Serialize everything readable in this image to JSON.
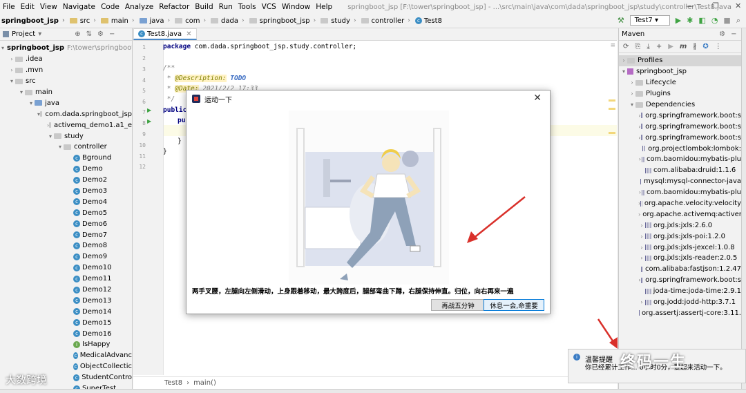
{
  "menu": [
    "File",
    "Edit",
    "View",
    "Navigate",
    "Code",
    "Analyze",
    "Refactor",
    "Build",
    "Run",
    "Tools",
    "VCS",
    "Window",
    "Help"
  ],
  "window_title": "springboot_jsp [F:\\tower\\springboot_jsp] - ...\\src\\main\\java\\com\\dada\\springboot_jsp\\study\\controller\\Test8.java",
  "breadcrumbs": [
    "springboot_jsp",
    "src",
    "main",
    "java",
    "com",
    "dada",
    "springboot_jsp",
    "study",
    "controller",
    "Test8"
  ],
  "run_config": "Test7",
  "project": {
    "header": "Project",
    "root_name": "springboot_jsp",
    "root_path": "F:\\tower\\springboot",
    "items": [
      ".idea",
      ".mvn",
      "src",
      "main",
      "java",
      "com.dada.springboot_jsp",
      "activemq_demo1.a1_e",
      "study",
      "controller"
    ],
    "classes": [
      "Bground",
      "Demo",
      "Demo2",
      "Demo3",
      "Demo4",
      "Demo5",
      "Demo6",
      "Demo7",
      "Demo8",
      "Demo9",
      "Demo10",
      "Demo11",
      "Demo12",
      "Demo13",
      "Demo14",
      "Demo15",
      "Demo16",
      "IsHappy",
      "MedicalAdvanc",
      "ObjectCollectic",
      "StudentContro",
      "SuperTest"
    ]
  },
  "editor": {
    "tab": "Test8.java",
    "line_numbers": [
      "1",
      "2",
      "3",
      "4",
      "5",
      "6",
      "7",
      "8",
      "9",
      "10",
      "11",
      "12"
    ],
    "package_kw": "package",
    "package_name": " com.dada.springboot_jsp.study.controller;",
    "c1": "/**",
    "c2_pre": " * ",
    "c2_tag": "@Description:",
    "c2_val": " TODO",
    "c3_pre": " * ",
    "c3_tag": "@Date:",
    "c3_val": " 2021/2/2 17:33",
    "c4": " */",
    "public_kw": "public",
    "publ": "publ",
    "brace1": "}",
    "brace2": "}",
    "status": [
      "Test8",
      "main()"
    ]
  },
  "maven": {
    "header": "Maven",
    "profiles": "Profiles",
    "project": "springboot_jsp",
    "lifecycle": "Lifecycle",
    "plugins": "Plugins",
    "dependencies": "Dependencies",
    "deps": [
      "org.springframework.boot:s",
      "org.springframework.boot:s",
      "org.springframework.boot:s",
      "org.projectlombok:lombok:",
      "com.baomidou:mybatis-plu",
      "com.alibaba:druid:1.1.6",
      "mysql:mysql-connector-java",
      "com.baomidou:mybatis-plu",
      "org.apache.velocity:velocity",
      "org.apache.activemq:activer",
      "org.jxls:jxls:2.6.0",
      "org.jxls:jxls-poi:1.2.0",
      "org.jxls:jxls-jexcel:1.0.8",
      "org.jxls:jxls-reader:2.0.5",
      "com.alibaba:fastjson:1.2.47",
      "org.springframework.boot:s",
      "joda-time:joda-time:2.9.1",
      "org.jodd:jodd-http:3.7.1",
      "org.assertj:assertj-core:3.11."
    ]
  },
  "dialog": {
    "title": "运动一下",
    "instruction": "两手叉腰，左腿向左侧滑动，上身跟着移动，最大跨度后，腿部弯曲下蹲，右腿保持伸直。归位，向右再来一遍",
    "btn_later": "再战五分钟",
    "btn_rest": "休息一会,命重要"
  },
  "toast": {
    "title": "温馨提醒",
    "body": "你已经累计工作...  0小时0分，要起来活动一下。"
  },
  "watermark": "终码一生",
  "watermark2": "大数跨境",
  "colors": {
    "accent": "#4a88c7",
    "arrow": "#d9302a"
  }
}
